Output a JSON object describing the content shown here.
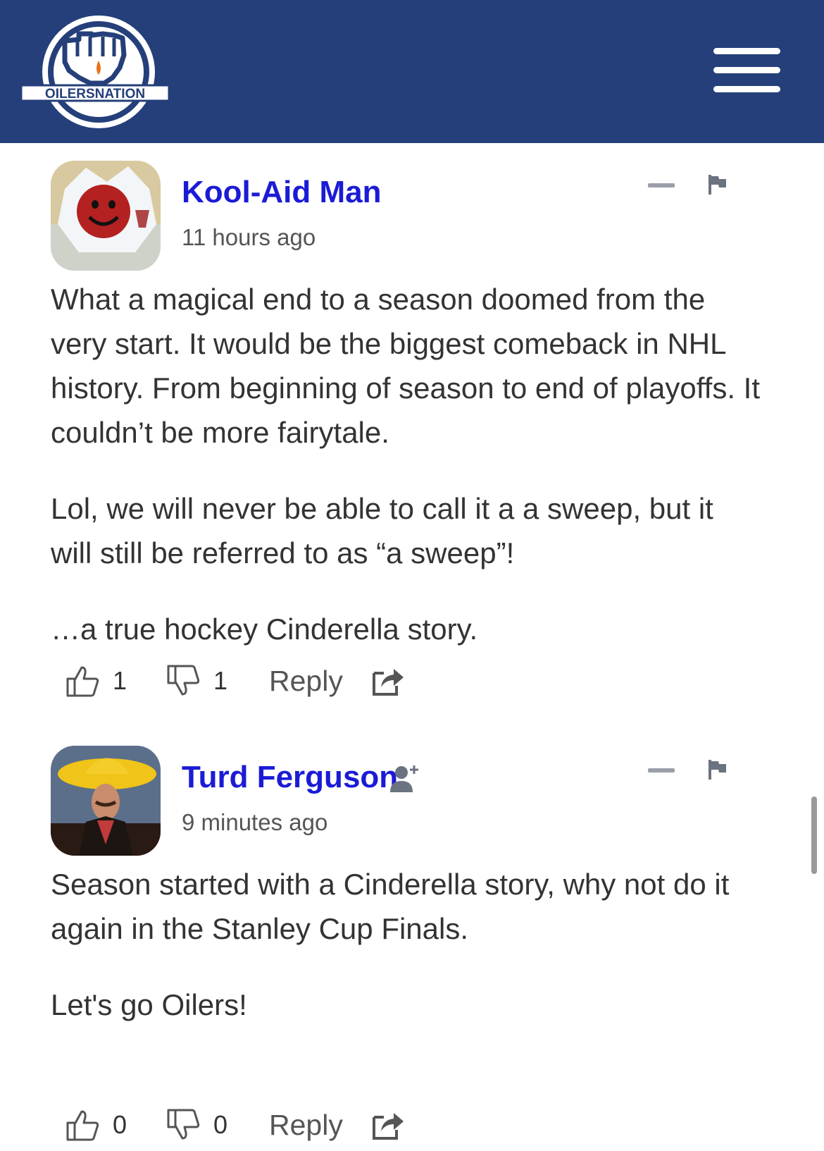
{
  "site": {
    "logo_text": "OILERSNATION",
    "brand_color": "#243f7a",
    "link_color": "#1b1bd6"
  },
  "comments": [
    {
      "author": "Kool-Aid Man",
      "time": "11 hours ago",
      "paragraphs": [
        "What a magical end to a season doomed from the very start. It would be the biggest comeback in NHL history. From beginning of season to end of playoffs. It couldn’t be more fairytale.",
        "Lol, we will never be able to call it a a sweep, but it will still be referred to as “a sweep”!",
        "…a true hockey Cinderella story."
      ],
      "likes": "1",
      "dislikes": "1",
      "reply_label": "Reply"
    },
    {
      "author": "Turd Ferguson",
      "time": "9 minutes ago",
      "paragraphs": [
        "Season started with a Cinderella story, why not do it again in the Stanley Cup Finals.",
        "Let's go Oilers!"
      ],
      "likes": "0",
      "dislikes": "0",
      "reply_label": "Reply"
    }
  ]
}
